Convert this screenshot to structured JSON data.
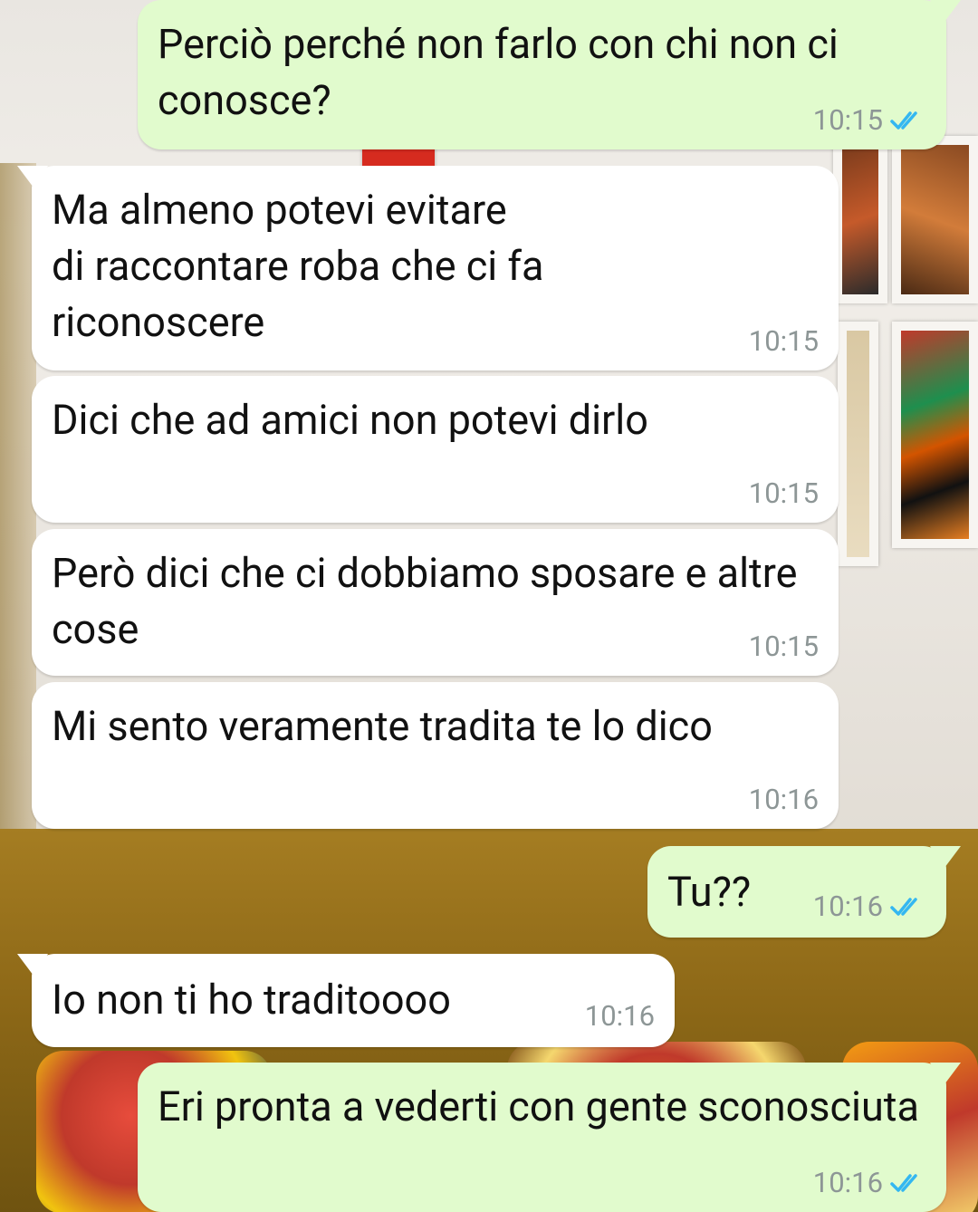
{
  "chat": {
    "messages": [
      {
        "direction": "out",
        "text": "Perciò perché non farlo con chi non ci conosce?",
        "time": "10:15",
        "status": "read-double-check-icon"
      },
      {
        "direction": "in",
        "text": "Ma almeno potevi evitare\ndi raccontare roba che ci fa\nriconoscere",
        "time": "10:15"
      },
      {
        "direction": "in",
        "text": "Dici che ad amici non potevi dirlo",
        "time": "10:15"
      },
      {
        "direction": "in",
        "text": "Però dici che ci dobbiamo sposare e altre cose",
        "time": "10:15"
      },
      {
        "direction": "in",
        "text": "Mi sento veramente tradita te lo dico",
        "time": "10:16"
      },
      {
        "direction": "out",
        "text": "Tu??",
        "time": "10:16",
        "status": "read-double-check-icon"
      },
      {
        "direction": "in",
        "text": "Io non ti ho traditoooo",
        "time": "10:16"
      },
      {
        "direction": "out",
        "text": "Eri pronta a vederti con gente sconosciuta",
        "time": "10:16",
        "status": "read-double-check-icon"
      }
    ]
  },
  "colors": {
    "incoming_bubble": "#ffffff",
    "outgoing_bubble": "#e1fbcd",
    "timestamp": "#8d9696",
    "read_ticks": "#34b7f1"
  }
}
